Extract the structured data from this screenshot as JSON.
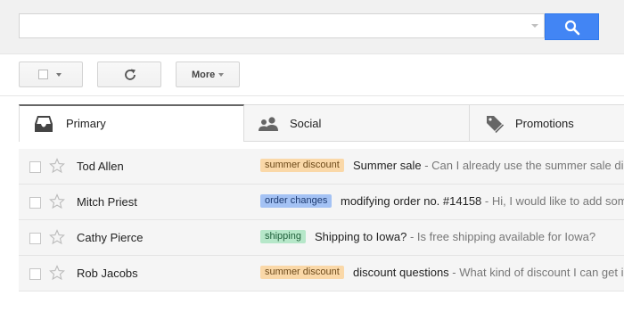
{
  "search": {
    "value": "",
    "placeholder": "",
    "button_icon": "search-icon"
  },
  "toolbar": {
    "select_icon": "checkbox",
    "refresh_icon": "refresh-icon",
    "more_label": "More"
  },
  "tabs": [
    {
      "label": "Primary",
      "icon": "inbox-icon",
      "active": true
    },
    {
      "label": "Social",
      "icon": "people-icon",
      "active": false
    },
    {
      "label": "Promotions",
      "icon": "tag-icon",
      "active": false
    }
  ],
  "colors": {
    "search_button": "#4285f4",
    "label_summer_discount_bg": "#fad8a8",
    "label_order_changes_bg": "#a4c2f4",
    "label_shipping_bg": "#b6e7c9"
  },
  "emails": [
    {
      "sender": "Tod Allen",
      "label": "summer discount",
      "subject": "Summer sale",
      "snippet": " - Can I already use the summer sale di"
    },
    {
      "sender": "Mitch Priest",
      "label": "order changes",
      "subject": "modifying order no. #14158",
      "snippet": " - Hi, I would like to add som"
    },
    {
      "sender": "Cathy Pierce",
      "label": "shipping",
      "subject": "Shipping to Iowa?",
      "snippet": " - Is free shipping available for Iowa?"
    },
    {
      "sender": "Rob Jacobs",
      "label": "summer discount",
      "subject": "discount questions",
      "snippet": " - What kind of discount I can get i"
    }
  ]
}
